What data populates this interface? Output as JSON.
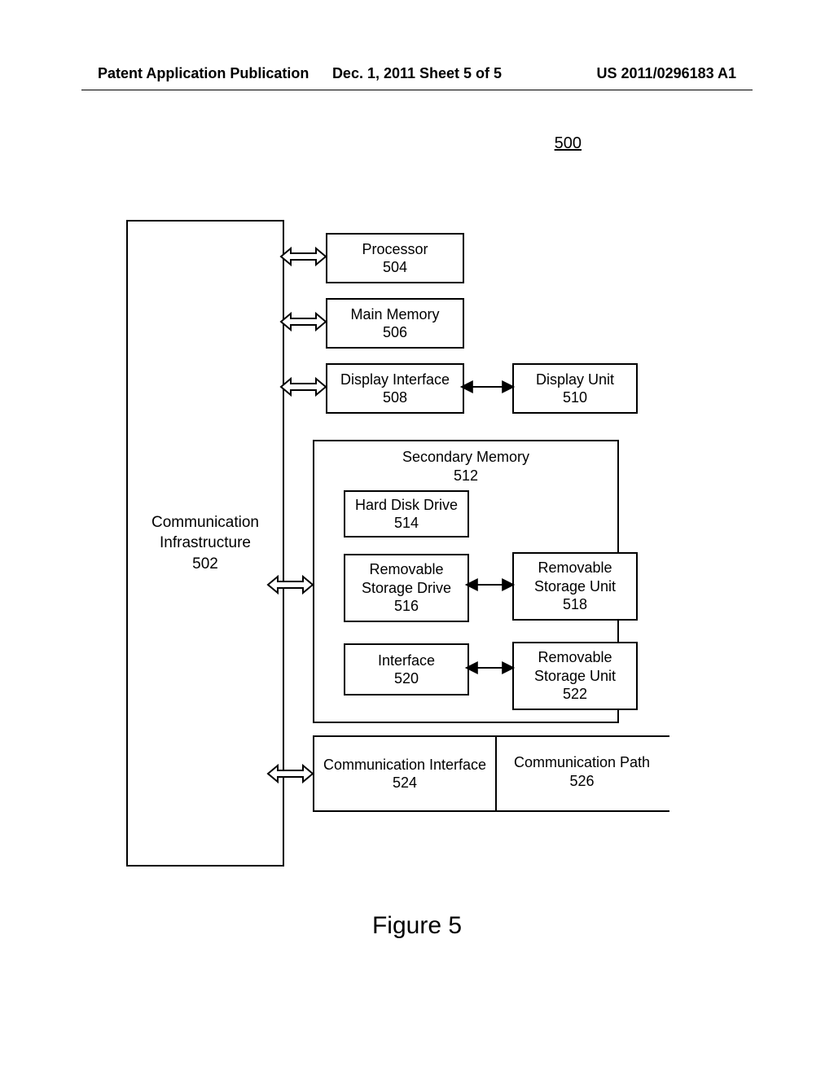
{
  "header": {
    "left": "Patent Application Publication",
    "center": "Dec. 1, 2011  Sheet 5 of 5",
    "right": "US 2011/0296183 A1"
  },
  "figure_ref": "500",
  "bus": {
    "label": "Communication Infrastructure",
    "num": "502"
  },
  "processor": {
    "label": "Processor",
    "num": "504"
  },
  "main_memory": {
    "label": "Main Memory",
    "num": "506"
  },
  "display_interface": {
    "label": "Display Interface",
    "num": "508"
  },
  "display_unit": {
    "label": "Display Unit",
    "num": "510"
  },
  "secondary_memory": {
    "label": "Secondary Memory",
    "num": "512"
  },
  "hdd": {
    "label": "Hard Disk Drive",
    "num": "514"
  },
  "rsd": {
    "label": "Removable Storage Drive",
    "num": "516"
  },
  "rsu1": {
    "label": "Removable Storage Unit",
    "num": "518"
  },
  "iface": {
    "label": "Interface",
    "num": "520"
  },
  "rsu2": {
    "label": "Removable Storage Unit",
    "num": "522"
  },
  "comm_iface": {
    "label": "Communication Interface",
    "num": "524"
  },
  "comm_path": {
    "label": "Communication Path",
    "num": "526"
  },
  "figure_label": "Figure 5"
}
